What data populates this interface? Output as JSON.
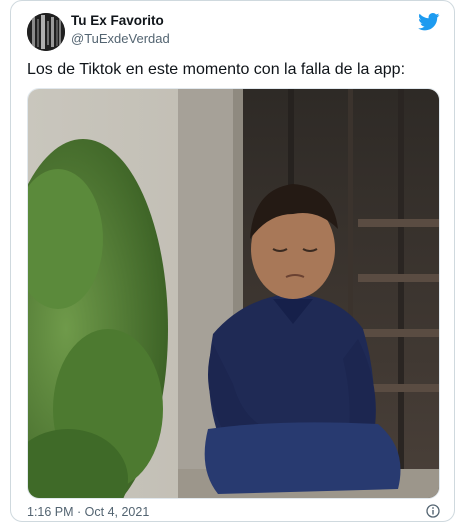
{
  "tweet": {
    "display_name": "Tu Ex Favorito",
    "handle": "@TuExdeVerdad",
    "text": "Los de Tiktok en este momento con la falla de la app:",
    "timestamp": "1:16 PM · Oct 4, 2021"
  },
  "colors": {
    "brand": "#1d9bf0",
    "text": "#0f1419",
    "secondary": "#536471",
    "border": "#cfd9de"
  },
  "icons": {
    "logo": "twitter-bird-icon",
    "info": "info-icon"
  }
}
